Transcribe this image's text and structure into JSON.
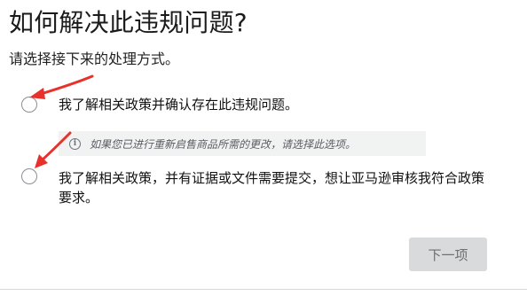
{
  "header": {
    "title": "如何解决此违规问题?",
    "subtitle": "请选择接下来的处理方式。"
  },
  "options": [
    {
      "label": "我了解相关政策并确认存在此违规问题。",
      "selected": false
    },
    {
      "label": "我了解相关政策，并有证据或文件需要提交，想让亚马逊审核我符合政策要求。",
      "selected": false
    }
  ],
  "info_note": {
    "icon": "info-icon",
    "text": "如果您已进行重新启售商品所需的更改，请选择此选项。"
  },
  "next_button": {
    "label": "下一项",
    "disabled": true
  },
  "colors": {
    "annotation_arrow": "#e8312a",
    "button_disabled_bg": "#d8dadb",
    "note_bg": "#f1f2f2"
  }
}
